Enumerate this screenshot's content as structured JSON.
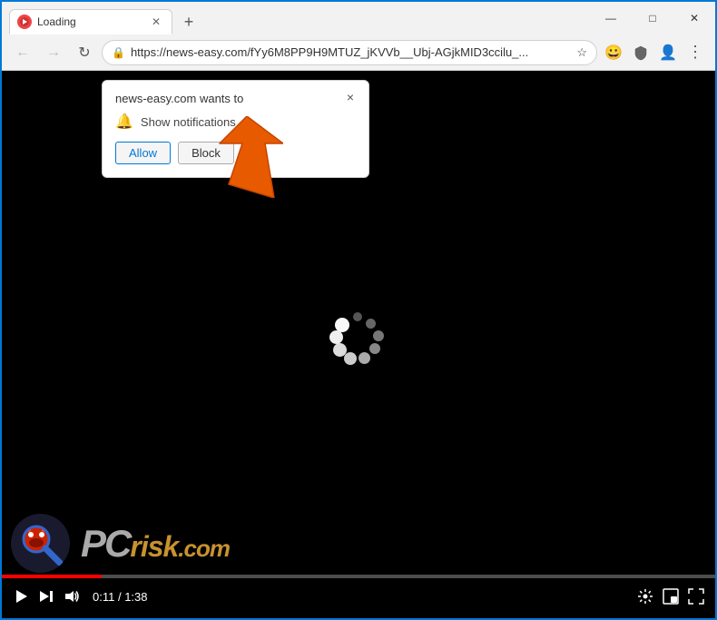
{
  "window": {
    "title": "Loading",
    "tab_label": "Loading",
    "controls": {
      "minimize": "—",
      "maximize": "□",
      "close": "✕"
    }
  },
  "titlebar": {
    "new_tab_label": "+"
  },
  "navbar": {
    "back_icon": "←",
    "forward_icon": "→",
    "reload_icon": "↻",
    "address": "https://news-easy.com/fYy6M8PP9H9MTUZ_jKVVb__Ubj-AGjkMID3ccilu_...",
    "star_icon": "☆",
    "more_icon": "⋮"
  },
  "popup": {
    "title": "news-easy.com wants to",
    "notification_label": "Show notifications",
    "close_label": "×",
    "allow_label": "Allow",
    "block_label": "Block"
  },
  "video": {
    "time_current": "0:11",
    "time_total": "1:38",
    "progress_percent": 14
  },
  "colors": {
    "accent": "#0078d7",
    "arrow_fill": "#e85a00",
    "arrow_stroke": "#c44800"
  }
}
